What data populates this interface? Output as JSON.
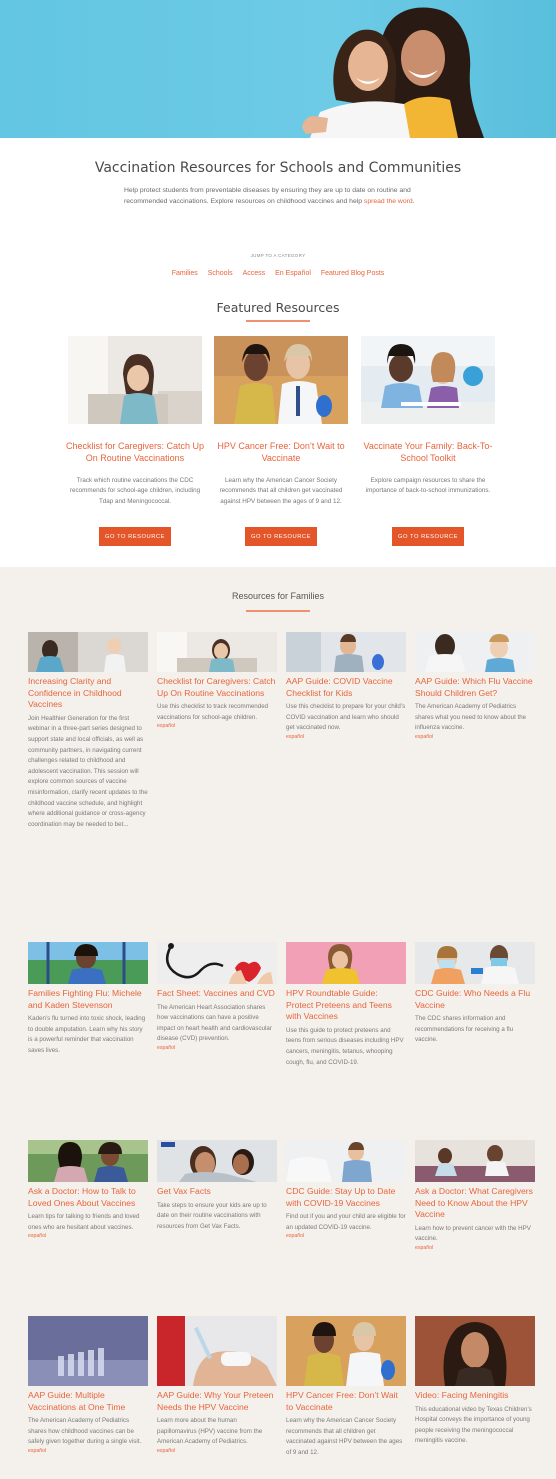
{
  "intro": {
    "title": "Vaccination Resources for Schools and Communities",
    "text": "Help protect students from preventable diseases by ensuring they are up to date on routine and recommended vaccinations. Explore resources on childhood vaccines and help ",
    "link": "spread the word",
    "period": "."
  },
  "jump": {
    "label": "JUMP TO A CATEGORY",
    "items": [
      "Families",
      "Schools",
      "Access",
      "En Español",
      "Featured Blog Posts"
    ]
  },
  "featured": {
    "title": "Featured Resources",
    "button_label": "GO TO RESOURCE",
    "cards": [
      {
        "title": "Checklist for Caregivers: Catch Up On Routine Vaccinations",
        "desc": "Track which routine vaccinations the CDC recommends for school-age children, including Tdap and Meningococcal.",
        "image": "girl-on-couch-photo"
      },
      {
        "title": "HPV Cancer Free: Don’t Wait to Vaccinate",
        "desc": "Learn why the American Cancer Society recommends that all children get vaccinated against HPV between the ages of 9 and 12.",
        "image": "girl-with-nurse-photo"
      },
      {
        "title": "Vaccinate Your Family: Back-To-School Toolkit",
        "desc": "Explore campaign resources to share the importance of back-to-school immunizations.",
        "image": "students-in-classroom-photo"
      }
    ]
  },
  "families": {
    "title": "Resources for Families",
    "cards": [
      {
        "title": "Increasing Clarity and Confidence in Childhood Vaccines",
        "desc": "Join Healthier Generation for the first webinar in a three-part series designed to support state and local officials, as well as community partners, in navigating current challenges related to childhood and adolescent vaccination. This session will explore common sources of vaccine misinformation, clarify recent updates to the childhood vaccine schedule, and highlight where additional guidance or cross-agency coordination may be needed to bet...",
        "link": ""
      },
      {
        "title": "Checklist for Caregivers: Catch Up On Routine Vaccinations",
        "desc": "Use this checklist to track recommended vaccinations for school-age children.",
        "link": "español"
      },
      {
        "title": "AAP Guide: COVID Vaccine Checklist for Kids",
        "desc": "Use this checklist to prepare for your child’s COVID vaccination and learn who should get vaccinated now.",
        "link": "español"
      },
      {
        "title": "AAP Guide: Which Flu Vaccine Should Children Get?",
        "desc": "The American Academy of Pediatrics shares what you need to know about the influenza vaccine.",
        "link": "español"
      },
      {
        "title": "Families Fighting Flu: Michele and Kaden Stevenson",
        "desc": "Kaden’s flu turned into toxic shock, leading to double amputation. Learn why his story is a powerful reminder that vaccination saves lives.",
        "link": ""
      },
      {
        "title": "Fact Sheet: Vaccines and CVD",
        "desc": "The American Heart Association shares how vaccinations can have a positive impact on heart health and cardiovascular disease (CVD) prevention.",
        "link": "español"
      },
      {
        "title": "HPV Roundtable Guide: Protect Preteens and Teens with Vaccines",
        "desc": "Use this guide to protect preteens and teens from serious diseases including HPV cancers, meningitis, tetanus, whooping cough, flu, and COVID-19.",
        "link": ""
      },
      {
        "title": "CDC Guide: Who Needs a Flu Vaccine",
        "desc": "The CDC shares information and recommendations for receiving a flu vaccine.",
        "link": ""
      },
      {
        "title": "Ask a Doctor: How to Talk to Loved Ones About Vaccines",
        "desc": "Learn tips for talking to friends and loved ones who are hesitant about vaccines.",
        "link": "español"
      },
      {
        "title": "Get Vax Facts",
        "desc": "Take steps to ensure your kids are up to date on their routine vaccinations with resources from Get Vax Facts.",
        "link": ""
      },
      {
        "title": "CDC Guide: Stay Up to Date with COVID-19 Vaccines",
        "desc": "Find out if you and your child are eligible for an updated COVID-19 vaccine.",
        "link": "español"
      },
      {
        "title": "Ask a Doctor: What Caregivers Need to Know About the HPV Vaccine",
        "desc": "Learn how to prevent cancer with the HPV vaccine.",
        "link": "español"
      },
      {
        "title": "AAP Guide: Multiple Vaccinations at One Time",
        "desc": "The American Academy of Pediatrics shares how childhood vaccines can be safely given together during a single visit.",
        "link": "español"
      },
      {
        "title": "AAP Guide: Why Your Preteen Needs the HPV Vaccine",
        "desc": "Learn more about the human papillomavirus (HPV) vaccine from the American Academy of Pediatrics.",
        "link": "español"
      },
      {
        "title": "HPV Cancer Free: Don’t Wait to Vaccinate",
        "desc": "Learn why the American Cancer Society recommends that all children get vaccinated against HPV between the ages of 9 and 12.",
        "link": ""
      },
      {
        "title": "Video: Facing Meningitis",
        "desc": "This educational video by Texas Children’s Hospital conveys the importance of young people receiving the meningococcal meningitis vaccine.",
        "link": ""
      }
    ]
  },
  "colors": {
    "accent": "#e8643c",
    "button": "#e5552a",
    "hero_bg": "#5cc3e0",
    "section_bg": "#f4f1ec"
  }
}
